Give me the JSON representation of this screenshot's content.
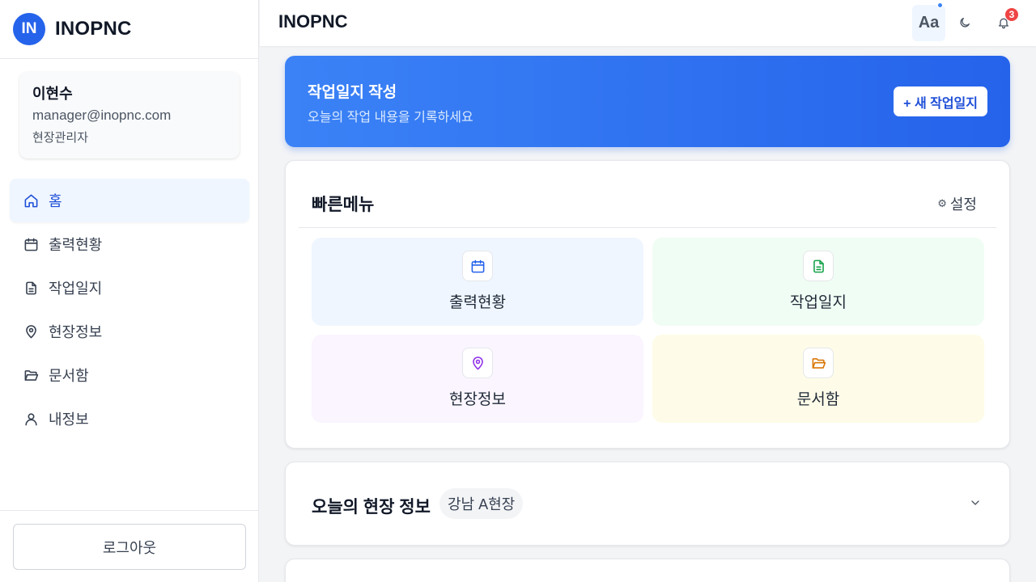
{
  "brand": {
    "logo_text": "IN",
    "name": "INOPNC"
  },
  "user": {
    "name": "이현수",
    "email": "manager@inopnc.com",
    "role": "현장관리자"
  },
  "nav": {
    "items": [
      {
        "label": "홈",
        "icon": "home-icon",
        "active": true
      },
      {
        "label": "출력현황",
        "icon": "calendar-icon"
      },
      {
        "label": "작업일지",
        "icon": "document-icon"
      },
      {
        "label": "현장정보",
        "icon": "map-pin-icon"
      },
      {
        "label": "문서함",
        "icon": "folder-open-icon"
      },
      {
        "label": "내정보",
        "icon": "user-icon"
      }
    ]
  },
  "logout_label": "로그아웃",
  "header": {
    "title": "INOPNC",
    "font_button": "Aa",
    "notification_count": "3"
  },
  "banner": {
    "title": "작업일지 작성",
    "subtitle": "오늘의 작업 내용을 기록하세요",
    "button_label": "+ 새 작업일지"
  },
  "quick_menu": {
    "title": "빠른메뉴",
    "settings_label": "설정",
    "tiles": [
      {
        "label": "출력현황",
        "icon": "calendar-icon",
        "color": "#2563eb"
      },
      {
        "label": "작업일지",
        "icon": "document-icon",
        "color": "#16a34a"
      },
      {
        "label": "현장정보",
        "icon": "map-pin-icon",
        "color": "#9333ea"
      },
      {
        "label": "문서함",
        "icon": "folder-open-icon",
        "color": "#d97706"
      }
    ]
  },
  "site_info": {
    "title": "오늘의 현장 정보",
    "site_name": "강남 A현장"
  },
  "colors": {
    "accent": "#2563eb",
    "badge": "#ef4444"
  }
}
